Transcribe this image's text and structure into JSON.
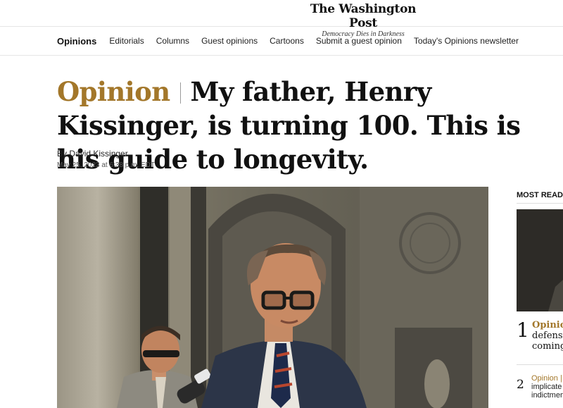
{
  "masthead": {
    "logo_name": "The Washington Post",
    "logo_tagline": "Democracy Dies in Darkness"
  },
  "section_nav": {
    "section_title": "Opinions",
    "links": [
      "Editorials",
      "Columns",
      "Guest opinions",
      "Cartoons",
      "Submit a guest opinion",
      "Today's Opinions newsletter"
    ]
  },
  "article": {
    "kicker": "Opinion",
    "headline": "My father, Henry Kissinger, is turning 100. This is his guide to longevity.",
    "byline_prefix": "By",
    "author": "David Kissinger",
    "timestamp": "May 25, 2023 at 6:38 p.m. EDT"
  },
  "right_rail": {
    "heading": "MOST READ",
    "items": [
      {
        "rank": "1",
        "kicker": "Opinion",
        "lines": [
          "defense",
          "coming"
        ]
      },
      {
        "rank": "2",
        "kicker": "Opinion |",
        "lines": [
          "implicate",
          "indictmen"
        ]
      }
    ]
  },
  "colors": {
    "kicker_gold": "#a3772a",
    "text": "#111111",
    "rule": "#e6e6e6"
  }
}
